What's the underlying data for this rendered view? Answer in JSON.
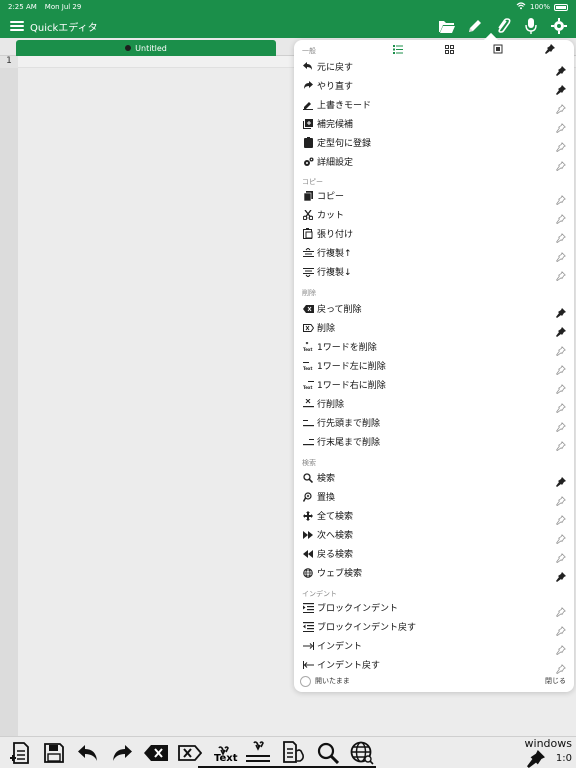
{
  "status_bar": {
    "time": "2:25 AM",
    "date": "Mon Jul 29",
    "battery": "100%"
  },
  "app": {
    "title": "Quickエディタ",
    "accent": "#1b8f4a"
  },
  "tab": {
    "title": "Untitled"
  },
  "editor": {
    "line_number": "1"
  },
  "menu": {
    "header": "一般",
    "general": [
      {
        "label": "元に戻す",
        "icon": "undo-icon",
        "pinned": true
      },
      {
        "label": "やり直す",
        "icon": "redo-icon",
        "pinned": true
      },
      {
        "label": "上書きモード",
        "icon": "pencil-icon",
        "pinned": false
      },
      {
        "label": "補完候補",
        "icon": "suggest-icon",
        "pinned": false
      },
      {
        "label": "定型句に登録",
        "icon": "clipboard-icon",
        "pinned": false
      },
      {
        "label": "詳細設定",
        "icon": "gears-icon",
        "pinned": false
      }
    ],
    "copy_header": "コピー",
    "copy": [
      {
        "label": "コピー",
        "icon": "copy-icon",
        "pinned": false
      },
      {
        "label": "カット",
        "icon": "scissors-icon",
        "pinned": false
      },
      {
        "label": "張り付け",
        "icon": "paste-icon",
        "pinned": false
      },
      {
        "label": "行複製↑",
        "icon": "dup-up-icon",
        "pinned": false
      },
      {
        "label": "行複製↓",
        "icon": "dup-down-icon",
        "pinned": false
      }
    ],
    "delete_header": "削除",
    "delete": [
      {
        "label": "戻って削除",
        "icon": "backspace-icon",
        "pinned": true
      },
      {
        "label": "削除",
        "icon": "delete-icon",
        "pinned": true
      },
      {
        "label": "1ワードを削除",
        "icon": "word-delete-icon",
        "pinned": false
      },
      {
        "label": "1ワード左に削除",
        "icon": "word-left-icon",
        "pinned": false
      },
      {
        "label": "1ワード右に削除",
        "icon": "word-right-icon",
        "pinned": false
      },
      {
        "label": "行削除",
        "icon": "line-delete-icon",
        "pinned": false
      },
      {
        "label": "行先頭まで削除",
        "icon": "line-start-icon",
        "pinned": false
      },
      {
        "label": "行末尾まで削除",
        "icon": "line-end-icon",
        "pinned": false
      }
    ],
    "search_header": "検索",
    "search": [
      {
        "label": "検索",
        "icon": "search-icon",
        "pinned": true
      },
      {
        "label": "置換",
        "icon": "replace-icon",
        "pinned": false
      },
      {
        "label": "全て検索",
        "icon": "move-icon",
        "pinned": false
      },
      {
        "label": "次へ検索",
        "icon": "forward-icon",
        "pinned": false
      },
      {
        "label": "戻る検索",
        "icon": "backward-icon",
        "pinned": false
      },
      {
        "label": "ウェブ検索",
        "icon": "globe-icon",
        "pinned": true
      }
    ],
    "indent_header": "インデント",
    "indent": [
      {
        "label": "ブロックインデント",
        "icon": "indent-block-icon",
        "pinned": false
      },
      {
        "label": "ブロックインデント戻す",
        "icon": "outdent-block-icon",
        "pinned": false
      },
      {
        "label": "インデント",
        "icon": "indent-icon",
        "pinned": false
      },
      {
        "label": "インデント戻す",
        "icon": "outdent-icon",
        "pinned": false
      }
    ],
    "footer_label": "開いたまま",
    "close_label": "閉じる"
  },
  "toolbar": {
    "text_label": "Text",
    "keyboard_label": "windows",
    "zoom": "1:0"
  }
}
